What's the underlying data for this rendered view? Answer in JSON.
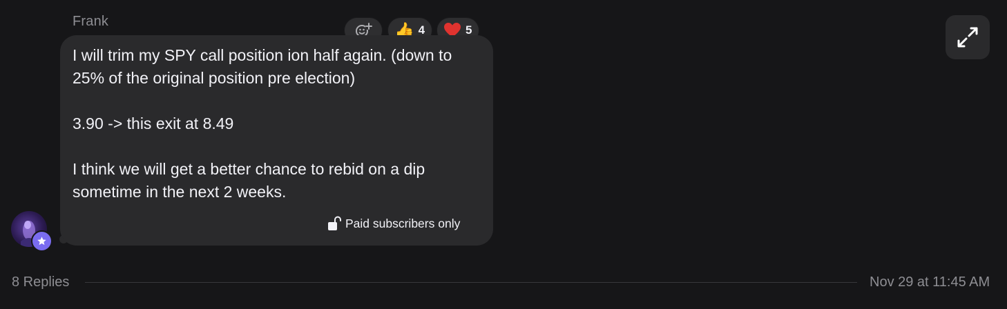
{
  "message": {
    "author": "Frank",
    "lines": [
      "I will trim my SPY call position ion half again. (down to",
      "25% of the original position pre election)",
      "3.90 -> this exit at 8.49",
      "I think we will get a better chance to rebid on a dip",
      "sometime in the next 2 weeks."
    ],
    "paywall_label": "Paid subscribers only"
  },
  "reactions": [
    {
      "icon": "add-reaction-icon",
      "count": ""
    },
    {
      "icon": "thumbs-up-icon",
      "emoji": "👍",
      "count": "4"
    },
    {
      "icon": "heart-icon",
      "emoji": "❤️",
      "count": "5"
    }
  ],
  "thread": {
    "replies_label": "8 Replies",
    "timestamp": "Nov 29 at 11:45 AM"
  },
  "colors": {
    "background": "#161618",
    "bubble": "#2a2a2c",
    "text": "#f2f2f7",
    "muted": "#8e8e93",
    "badge": "#7a6cf0",
    "heart": "#e0332f"
  },
  "icons": {
    "expand": "expand-arrows-icon",
    "lock": "unlocked-padlock-icon",
    "badge": "star-badge-icon",
    "avatar": "user-avatar"
  }
}
